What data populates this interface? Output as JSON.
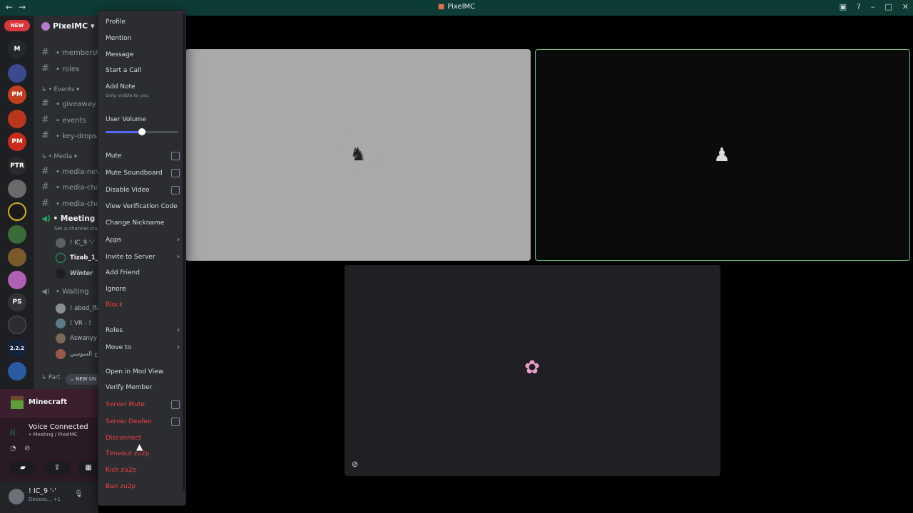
{
  "window": {
    "title": "PixelMC",
    "back": "←",
    "forward": "→"
  },
  "titlebar_icons": [
    "inbox-icon",
    "help-icon",
    "minimize-icon",
    "maximize-icon",
    "close-icon"
  ],
  "rail": {
    "new_badge": "NEW",
    "servers": [
      "M",
      "",
      "PM",
      "",
      "PM",
      "PTR",
      "",
      "",
      "",
      "",
      "",
      "PS",
      "",
      "2.2.2",
      ""
    ]
  },
  "sidebar": {
    "guild_name": "PixelMC ▾",
    "channels": [
      {
        "label": "membersh"
      },
      {
        "label": "roles"
      }
    ],
    "events_category": "Events ▾",
    "event_channels": [
      {
        "label": "giveaway"
      },
      {
        "label": "events"
      },
      {
        "label": "key-drops"
      }
    ],
    "media_category": "Media ▾",
    "media_channels": [
      {
        "label": "media-nev"
      },
      {
        "label": "media-cha"
      },
      {
        "label": "media-cha"
      }
    ],
    "meeting": {
      "label": "Meeting",
      "status": "Set a channel sta"
    },
    "meeting_members": [
      "! IC_9 '-'",
      "Tizab_1_",
      "Winter"
    ],
    "waiting": {
      "label": "Waiting"
    },
    "waiting_members": [
      "! abod_lfa",
      "! VR - !",
      "Aswanyy",
      "فتاح السوسي"
    ],
    "part_category": "Part",
    "new_unread": "NEW UN"
  },
  "activity": {
    "game": "Minecraft"
  },
  "voice": {
    "status": "Voice Connected",
    "location": "Meeting / PixelMC"
  },
  "user": {
    "name": "! IC_9 '-'",
    "status": "Deceas... +1"
  },
  "context_menu": {
    "profile": "Profile",
    "mention": "Mention",
    "message": "Message",
    "start_call": "Start a Call",
    "add_note": "Add Note",
    "add_note_hint": "Only visible to you",
    "user_volume": "User Volume",
    "volume_level": 0.5,
    "mute": "Mute",
    "mute_soundboard": "Mute Soundboard",
    "disable_video": "Disable Video",
    "view_verification": "View Verification Code",
    "change_nickname": "Change Nickname",
    "apps": "Apps",
    "invite_to_server": "Invite to Server",
    "add_friend": "Add Friend",
    "ignore": "Ignore",
    "block": "Block",
    "roles": "Roles",
    "move_to": "Move to",
    "open_mod_view": "Open in Mod View",
    "verify_member": "Verify Member",
    "server_mute": "Server Mute",
    "server_deafen": "Server Deafen",
    "disconnect": "Disconnect",
    "timeout": "Timeout zu2p",
    "kick": "Kick zu2p",
    "ban": "Ban zu2p"
  },
  "colors": {
    "titlebar": "#0d3b36",
    "danger": "#f23f43",
    "accent": "#5865f2",
    "speaking": "#6cbf7a"
  }
}
